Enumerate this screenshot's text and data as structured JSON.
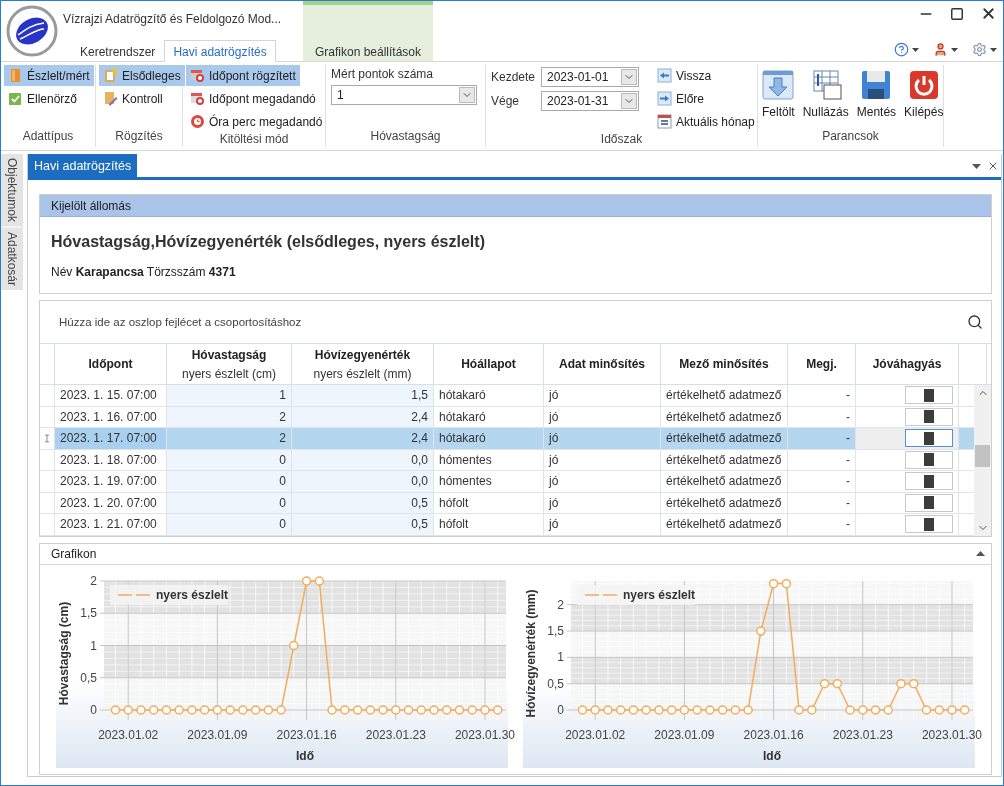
{
  "window": {
    "title": "Vízrajzi Adatrögzítő és Feldolgozó Mod..."
  },
  "ribbon_tabs": [
    {
      "label": "Keretrendszer",
      "selected": false,
      "contextual": false
    },
    {
      "label": "Havi adatrögzítés",
      "selected": true,
      "contextual": false
    },
    {
      "label": "Grafikon beállítások",
      "selected": false,
      "contextual": true
    }
  ],
  "ribbon_groups": [
    {
      "label": "Adattípus",
      "kind": "options",
      "items": [
        {
          "label": "Észlelt/mért",
          "selected": true
        },
        {
          "label": "Ellenörző",
          "selected": false
        }
      ]
    },
    {
      "label": "Rögzítés",
      "kind": "options",
      "items": [
        {
          "label": "Elsődleges",
          "selected": true
        },
        {
          "label": "Kontroll",
          "selected": false
        }
      ]
    },
    {
      "label": "Kitöltési mód",
      "kind": "options",
      "items": [
        {
          "label": "Időpont rögzített",
          "selected": true
        },
        {
          "label": "Időpont megadandó",
          "selected": false
        },
        {
          "label": "Óra perc megadandó",
          "selected": false
        }
      ]
    },
    {
      "label": "Hóvastagság",
      "kind": "dropdown",
      "field_label": "Mért pontok száma",
      "value": "1"
    },
    {
      "label": "Időszak",
      "kind": "period",
      "fields": [
        {
          "label": "Kezdete",
          "value": "2023-01-01"
        },
        {
          "label": "Vége",
          "value": "2023-01-31"
        }
      ],
      "items": [
        {
          "label": "Vissza"
        },
        {
          "label": "Előre"
        },
        {
          "label": "Aktuális hónap"
        }
      ]
    },
    {
      "label": "Parancsok",
      "kind": "commands",
      "items": [
        {
          "label": "Feltölt"
        },
        {
          "label": "Nullázás"
        },
        {
          "label": "Mentés"
        },
        {
          "label": "Kilépés"
        }
      ]
    }
  ],
  "side_panels": [
    "Objektumok",
    "Adatkosár"
  ],
  "document_tab": {
    "label": "Havi adatrögzítés"
  },
  "station": {
    "header": "Kijelölt állomás",
    "title": "Hóvastagság,Hóvízegyenérték (elsődleges, nyers észlelt)",
    "details": "Név **Karapancsa** Törzsszám **4371**"
  },
  "grid": {
    "group_hint": "Húzza ide az oszlop fejlécet a csoportosításhoz",
    "columns": [
      {
        "title": "Időpont",
        "kind": "date"
      },
      {
        "title": "Hóvastagság",
        "subtitle": "nyers észlelt (cm)",
        "kind": "number"
      },
      {
        "title": "Hóvízegyenérték",
        "subtitle": "nyers észlelt (mm)",
        "kind": "number"
      },
      {
        "title": "Hóállapot",
        "kind": "text"
      },
      {
        "title": "Adat minősítés",
        "kind": "text"
      },
      {
        "title": "Mező minősítés",
        "kind": "text"
      },
      {
        "title": "Megj.",
        "kind": "remark"
      },
      {
        "title": "Jóváhagyás",
        "kind": "approval"
      }
    ],
    "rows": [
      {
        "selected": false,
        "cells": [
          "2023. 1. 15. 07:00",
          "1",
          "1,5",
          "hótakaró",
          "jó",
          "értékelhető adatmező",
          "-"
        ]
      },
      {
        "selected": false,
        "cells": [
          "2023. 1. 16. 07:00",
          "2",
          "2,4",
          "hótakaró",
          "jó",
          "értékelhető adatmező",
          "-"
        ]
      },
      {
        "selected": true,
        "cells": [
          "2023. 1. 17. 07:00",
          "2",
          "2,4",
          "hótakaró",
          "jó",
          "értékelhető adatmező",
          "-"
        ]
      },
      {
        "selected": false,
        "cells": [
          "2023. 1. 18. 07:00",
          "0",
          "0,0",
          "hómentes",
          "jó",
          "értékelhető adatmező",
          "-"
        ]
      },
      {
        "selected": false,
        "cells": [
          "2023. 1. 19. 07:00",
          "0",
          "0,0",
          "hómentes",
          "jó",
          "értékelhető adatmező",
          "-"
        ]
      },
      {
        "selected": false,
        "cells": [
          "2023. 1. 20. 07:00",
          "0",
          "0,5",
          "hófolt",
          "jó",
          "értékelhető adatmező",
          "-"
        ]
      },
      {
        "selected": false,
        "cells": [
          "2023. 1. 21. 07:00",
          "0",
          "0,5",
          "hófolt",
          "jó",
          "értékelhető adatmező",
          "-"
        ]
      }
    ]
  },
  "chart_panel": {
    "title": "Grafikon",
    "expanded": true,
    "charts": [
      {
        "chart_data": {
          "type": "line",
          "xlabel": "Idő",
          "ylabel": "Hóvastagság (cm)",
          "categories": [
            null,
            "2023.01.02",
            null,
            null,
            null,
            null,
            null,
            null,
            "2023.01.09",
            null,
            null,
            null,
            null,
            null,
            null,
            "2023.01.16",
            null,
            null,
            null,
            null,
            null,
            null,
            "2023.01.23",
            null,
            null,
            null,
            null,
            null,
            null,
            "2023.01.30",
            null
          ],
          "ylim": [
            0,
            2
          ],
          "grid": true,
          "bands": [
            {
              "axis": "y",
              "from": 0.5,
              "to": 1
            },
            {
              "axis": "y",
              "from": 1.5,
              "to": 2
            }
          ],
          "yticks": [
            {
              "value": 0,
              "label": "0"
            },
            {
              "value": 0.5,
              "label": "0,5"
            },
            {
              "value": 1,
              "label": "1"
            },
            {
              "value": 1.5,
              "label": "1,5"
            },
            {
              "value": 2,
              "label": "2"
            }
          ],
          "series": [
            {
              "name": "nyers észlelt",
              "color": "#f2ac5c",
              "marker": "o",
              "values": [
                0,
                0,
                0,
                0,
                0,
                0,
                0,
                0,
                0,
                0,
                0,
                0,
                0,
                0,
                1,
                2,
                2,
                0,
                0,
                0,
                0,
                0,
                0,
                0,
                0,
                0,
                0,
                0,
                0,
                0,
                0
              ]
            }
          ]
        }
      },
      {
        "chart_data": {
          "type": "line",
          "xlabel": "Idő",
          "ylabel": "Hóvízegyenérték (mm)",
          "categories": [
            null,
            "2023.01.02",
            null,
            null,
            null,
            null,
            null,
            null,
            "2023.01.09",
            null,
            null,
            null,
            null,
            null,
            null,
            "2023.01.16",
            null,
            null,
            null,
            null,
            null,
            null,
            "2023.01.23",
            null,
            null,
            null,
            null,
            null,
            null,
            "2023.01.30",
            null
          ],
          "ylim": [
            0,
            2.45
          ],
          "grid": true,
          "bands": [
            {
              "axis": "y",
              "from": 0.5,
              "to": 1
            },
            {
              "axis": "y",
              "from": 1.5,
              "to": 2
            }
          ],
          "yticks": [
            {
              "value": 0,
              "label": "0"
            },
            {
              "value": 0.5,
              "label": "0,5"
            },
            {
              "value": 1,
              "label": "1"
            },
            {
              "value": 1.5,
              "label": "1,5"
            },
            {
              "value": 2,
              "label": "2"
            }
          ],
          "series": [
            {
              "name": "nyers észlelt",
              "color": "#f2ac5c",
              "marker": "o",
              "values": [
                0,
                0,
                0,
                0,
                0,
                0,
                0,
                0,
                0,
                0,
                0,
                0,
                0,
                0,
                1.5,
                2.4,
                2.4,
                0,
                0,
                0.5,
                0.5,
                0,
                0,
                0,
                0,
                0.5,
                0.5,
                0,
                0,
                0,
                0
              ]
            }
          ]
        }
      }
    ]
  }
}
